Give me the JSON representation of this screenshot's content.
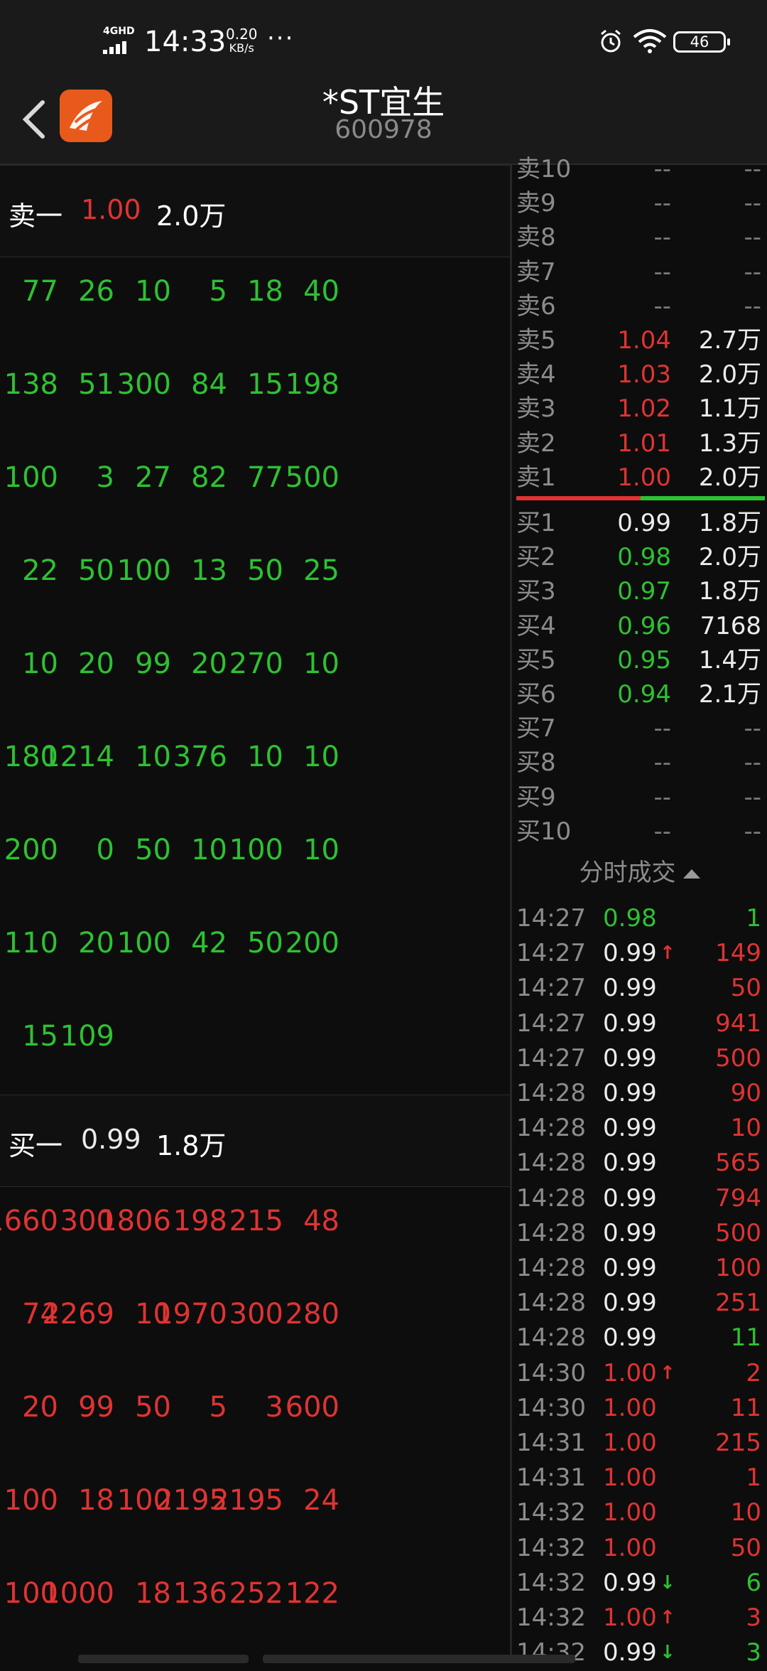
{
  "status_bar": {
    "network": "4GHD",
    "time": "14:33",
    "speed_value": "0.20",
    "speed_unit": "KB/s",
    "more": "···",
    "battery": "46"
  },
  "header": {
    "title": "*ST宜生",
    "code": "600978"
  },
  "colors": {
    "up": "#e03333",
    "down": "#2ec132",
    "neutral": "#ececec"
  },
  "sell_section": {
    "label": "卖一",
    "price": "1.00",
    "volume": "2.0万",
    "rows": [
      [
        "77",
        "26",
        "10",
        "5",
        "18",
        "40"
      ],
      [
        "138",
        "51",
        "300",
        "84",
        "15",
        "198"
      ],
      [
        "100",
        "3",
        "27",
        "82",
        "77",
        "500"
      ],
      [
        "22",
        "50",
        "100",
        "13",
        "50",
        "25"
      ],
      [
        "10",
        "20",
        "99",
        "20",
        "270",
        "10"
      ],
      [
        "180",
        "1214",
        "10",
        "376",
        "10",
        "10"
      ],
      [
        "200",
        "0",
        "50",
        "10",
        "100",
        "10"
      ],
      [
        "110",
        "20",
        "100",
        "42",
        "50",
        "200"
      ],
      [
        "15",
        "109"
      ]
    ]
  },
  "buy_section": {
    "label": "买一",
    "price": "0.99",
    "volume": "1.8万",
    "rows": [
      [
        "1660",
        "300",
        "1806",
        "198",
        "215",
        "48"
      ],
      [
        "74",
        "2269",
        "10",
        "1970",
        "300",
        "280"
      ],
      [
        "20",
        "99",
        "50",
        "5",
        "3",
        "600"
      ],
      [
        "100",
        "18",
        "100",
        "2195",
        "2195",
        "24"
      ],
      [
        "100",
        "1000",
        "18",
        "136",
        "252",
        "122"
      ]
    ]
  },
  "order_book": {
    "asks": [
      {
        "name": "卖10",
        "price": "--",
        "vol": "--",
        "color": "grey"
      },
      {
        "name": "卖9",
        "price": "--",
        "vol": "--",
        "color": "grey"
      },
      {
        "name": "卖8",
        "price": "--",
        "vol": "--",
        "color": "grey"
      },
      {
        "name": "卖7",
        "price": "--",
        "vol": "--",
        "color": "grey"
      },
      {
        "name": "卖6",
        "price": "--",
        "vol": "--",
        "color": "grey"
      },
      {
        "name": "卖5",
        "price": "1.04",
        "vol": "2.7万",
        "color": "red"
      },
      {
        "name": "卖4",
        "price": "1.03",
        "vol": "2.0万",
        "color": "red"
      },
      {
        "name": "卖3",
        "price": "1.02",
        "vol": "1.1万",
        "color": "red"
      },
      {
        "name": "卖2",
        "price": "1.01",
        "vol": "1.3万",
        "color": "red"
      },
      {
        "name": "卖1",
        "price": "1.00",
        "vol": "2.0万",
        "color": "red"
      }
    ],
    "bids": [
      {
        "name": "买1",
        "price": "0.99",
        "vol": "1.8万",
        "color": "white"
      },
      {
        "name": "买2",
        "price": "0.98",
        "vol": "2.0万",
        "color": "green"
      },
      {
        "name": "买3",
        "price": "0.97",
        "vol": "1.8万",
        "color": "green"
      },
      {
        "name": "买4",
        "price": "0.96",
        "vol": "7168",
        "color": "green"
      },
      {
        "name": "买5",
        "price": "0.95",
        "vol": "1.4万",
        "color": "green"
      },
      {
        "name": "买6",
        "price": "0.94",
        "vol": "2.1万",
        "color": "green"
      },
      {
        "name": "买7",
        "price": "--",
        "vol": "--",
        "color": "grey"
      },
      {
        "name": "买8",
        "price": "--",
        "vol": "--",
        "color": "grey"
      },
      {
        "name": "买9",
        "price": "--",
        "vol": "--",
        "color": "grey"
      },
      {
        "name": "买10",
        "price": "--",
        "vol": "--",
        "color": "grey"
      }
    ],
    "ask_ratio": 0.5
  },
  "trades": {
    "title": "分时成交",
    "rows": [
      {
        "time": "14:27",
        "price": "0.98",
        "pcolor": "green",
        "arrow": "",
        "vol": "1",
        "vcolor": "green"
      },
      {
        "time": "14:27",
        "price": "0.99",
        "pcolor": "white",
        "arrow": "↑",
        "vol": "149",
        "vcolor": "red"
      },
      {
        "time": "14:27",
        "price": "0.99",
        "pcolor": "white",
        "arrow": "",
        "vol": "50",
        "vcolor": "red"
      },
      {
        "time": "14:27",
        "price": "0.99",
        "pcolor": "white",
        "arrow": "",
        "vol": "941",
        "vcolor": "red"
      },
      {
        "time": "14:27",
        "price": "0.99",
        "pcolor": "white",
        "arrow": "",
        "vol": "500",
        "vcolor": "red"
      },
      {
        "time": "14:28",
        "price": "0.99",
        "pcolor": "white",
        "arrow": "",
        "vol": "90",
        "vcolor": "red"
      },
      {
        "time": "14:28",
        "price": "0.99",
        "pcolor": "white",
        "arrow": "",
        "vol": "10",
        "vcolor": "red"
      },
      {
        "time": "14:28",
        "price": "0.99",
        "pcolor": "white",
        "arrow": "",
        "vol": "565",
        "vcolor": "red"
      },
      {
        "time": "14:28",
        "price": "0.99",
        "pcolor": "white",
        "arrow": "",
        "vol": "794",
        "vcolor": "red"
      },
      {
        "time": "14:28",
        "price": "0.99",
        "pcolor": "white",
        "arrow": "",
        "vol": "500",
        "vcolor": "red"
      },
      {
        "time": "14:28",
        "price": "0.99",
        "pcolor": "white",
        "arrow": "",
        "vol": "100",
        "vcolor": "red"
      },
      {
        "time": "14:28",
        "price": "0.99",
        "pcolor": "white",
        "arrow": "",
        "vol": "251",
        "vcolor": "red"
      },
      {
        "time": "14:28",
        "price": "0.99",
        "pcolor": "white",
        "arrow": "",
        "vol": "11",
        "vcolor": "green"
      },
      {
        "time": "14:30",
        "price": "1.00",
        "pcolor": "red",
        "arrow": "↑",
        "vol": "2",
        "vcolor": "red"
      },
      {
        "time": "14:30",
        "price": "1.00",
        "pcolor": "red",
        "arrow": "",
        "vol": "11",
        "vcolor": "red"
      },
      {
        "time": "14:31",
        "price": "1.00",
        "pcolor": "red",
        "arrow": "",
        "vol": "215",
        "vcolor": "red"
      },
      {
        "time": "14:31",
        "price": "1.00",
        "pcolor": "red",
        "arrow": "",
        "vol": "1",
        "vcolor": "red"
      },
      {
        "time": "14:32",
        "price": "1.00",
        "pcolor": "red",
        "arrow": "",
        "vol": "10",
        "vcolor": "red"
      },
      {
        "time": "14:32",
        "price": "1.00",
        "pcolor": "red",
        "arrow": "",
        "vol": "50",
        "vcolor": "red"
      },
      {
        "time": "14:32",
        "price": "0.99",
        "pcolor": "white",
        "arrow": "↓",
        "vol": "6",
        "vcolor": "green"
      },
      {
        "time": "14:32",
        "price": "1.00",
        "pcolor": "red",
        "arrow": "↑",
        "vol": "3",
        "vcolor": "red"
      },
      {
        "time": "14:32",
        "price": "0.99",
        "pcolor": "white",
        "arrow": "↓",
        "vol": "3",
        "vcolor": "green"
      }
    ]
  }
}
